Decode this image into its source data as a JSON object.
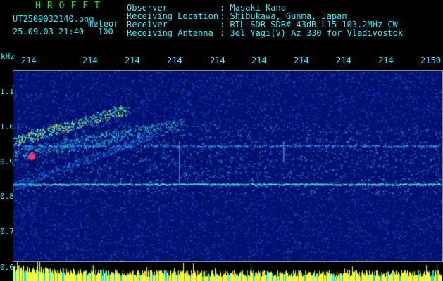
{
  "header": {
    "program_name": "HROFFT",
    "filename": "UT2509032140.png",
    "mode_label": "meteor",
    "date_time": "25.09.03 21:40",
    "gain_value": "100",
    "info_labels": [
      "Observer",
      "Receiving Location",
      "Receiver",
      "Receiving Antenna"
    ],
    "info_values": [
      ": Masaki Kano",
      ": Shibukawa, Gunma, Japan",
      ": RTL-SDR SDR# 43dB L15 103.2MHz CW",
      ": 3el Yagi(V) Az 330 for Vladivostok"
    ]
  },
  "axes": {
    "y_unit": "kHz",
    "y_ticks": [
      "1.1",
      "1.0",
      "0.9",
      "0.8",
      "0.7",
      "0.6"
    ],
    "x_ticks": [
      "214",
      "214",
      "214",
      "214",
      "214",
      "214",
      "214",
      "214",
      "214",
      "2150"
    ]
  },
  "colors": {
    "background": "#00106e",
    "label_cyan": "#2af0ff",
    "program_green": "#20e020",
    "amplitude_yellow": "#ffff30",
    "amplitude_cyan": "#00d8ff"
  }
}
